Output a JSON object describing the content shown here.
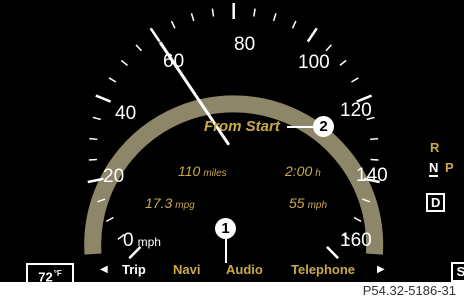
{
  "speedometer": {
    "speed_labels": [
      "0",
      "20",
      "40",
      "60",
      "80",
      "100",
      "120",
      "140",
      "160"
    ],
    "unit": "mph",
    "needle_speed_mph": 60
  },
  "trip_computer": {
    "title": "From Start",
    "distance_value": "110",
    "distance_unit": "miles",
    "time_value": "2:00",
    "time_unit": "h",
    "consumption_value": "17.3",
    "consumption_unit": "mpg",
    "avg_speed_value": "55",
    "avg_speed_unit": "mph"
  },
  "callouts": {
    "first": "1",
    "second": "2"
  },
  "transmission": {
    "r": "R",
    "n": "N",
    "p": "P",
    "d": "D",
    "active": "D"
  },
  "temperature": {
    "value": "72",
    "unit": "°F"
  },
  "menu": {
    "items": [
      "Trip",
      "Navi",
      "Audio",
      "Telephone"
    ],
    "active": "Trip",
    "right_edge_label": "S"
  },
  "colors": {
    "background": "#000000",
    "gauge_ring": "#8e8668",
    "text_white": "#ffffff",
    "text_gold": "#c9a94a",
    "menu_inactive": "#c9a94a"
  },
  "icons": {
    "menu_left": "triangle-left-icon",
    "menu_right": "triangle-right-icon"
  },
  "figure_code": "P54.32-5186-31"
}
